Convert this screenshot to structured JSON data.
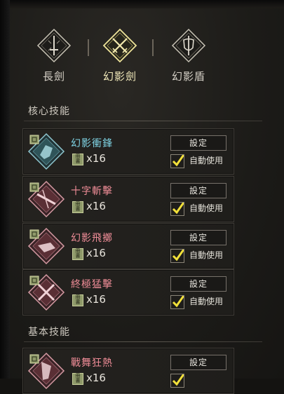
{
  "weapon_tabs": [
    {
      "label": "長劍",
      "icon": "sword-icon",
      "active": false
    },
    {
      "label": "幻影劍",
      "icon": "crossed-swords-icon",
      "active": true
    },
    {
      "label": "幻影盾",
      "icon": "shield-sword-icon",
      "active": false
    }
  ],
  "sections": {
    "core_skills": "核心技能",
    "basic_skills": "基本技能"
  },
  "skills": [
    {
      "name": "幻影衝鋒",
      "count": "x16",
      "set_label": "設定",
      "auto_label": "自動使用",
      "auto_checked": true,
      "name_color": "#7fd3e4",
      "icon": "phantom-charge-icon",
      "badge": "skill-book-icon"
    },
    {
      "name": "十字斬擊",
      "count": "x16",
      "set_label": "設定",
      "auto_label": "自動使用",
      "auto_checked": true,
      "name_color": "#f08d98",
      "icon": "cross-slash-icon",
      "badge": "skill-book-icon"
    },
    {
      "name": "幻影飛擲",
      "count": "x16",
      "set_label": "設定",
      "auto_label": "自動使用",
      "auto_checked": true,
      "name_color": "#f08d98",
      "icon": "phantom-throw-icon",
      "badge": "skill-book-icon"
    },
    {
      "name": "終極猛擊",
      "count": "x16",
      "set_label": "設定",
      "auto_label": "自動使用",
      "auto_checked": true,
      "name_color": "#f08d98",
      "icon": "ultimate-strike-icon",
      "badge": "skill-book-icon"
    }
  ],
  "basic_skills": [
    {
      "name": "戰舞狂熱",
      "count": "x16",
      "set_label": "設定",
      "name_color": "#f08d98",
      "icon": "war-dance-icon",
      "badge": "skill-book-icon"
    }
  ],
  "colors": {
    "accent_gold": "#e8d98a",
    "check_yellow": "#f2e13a",
    "cyan_skill": "#7fd3e4",
    "red_skill": "#f08d98"
  }
}
